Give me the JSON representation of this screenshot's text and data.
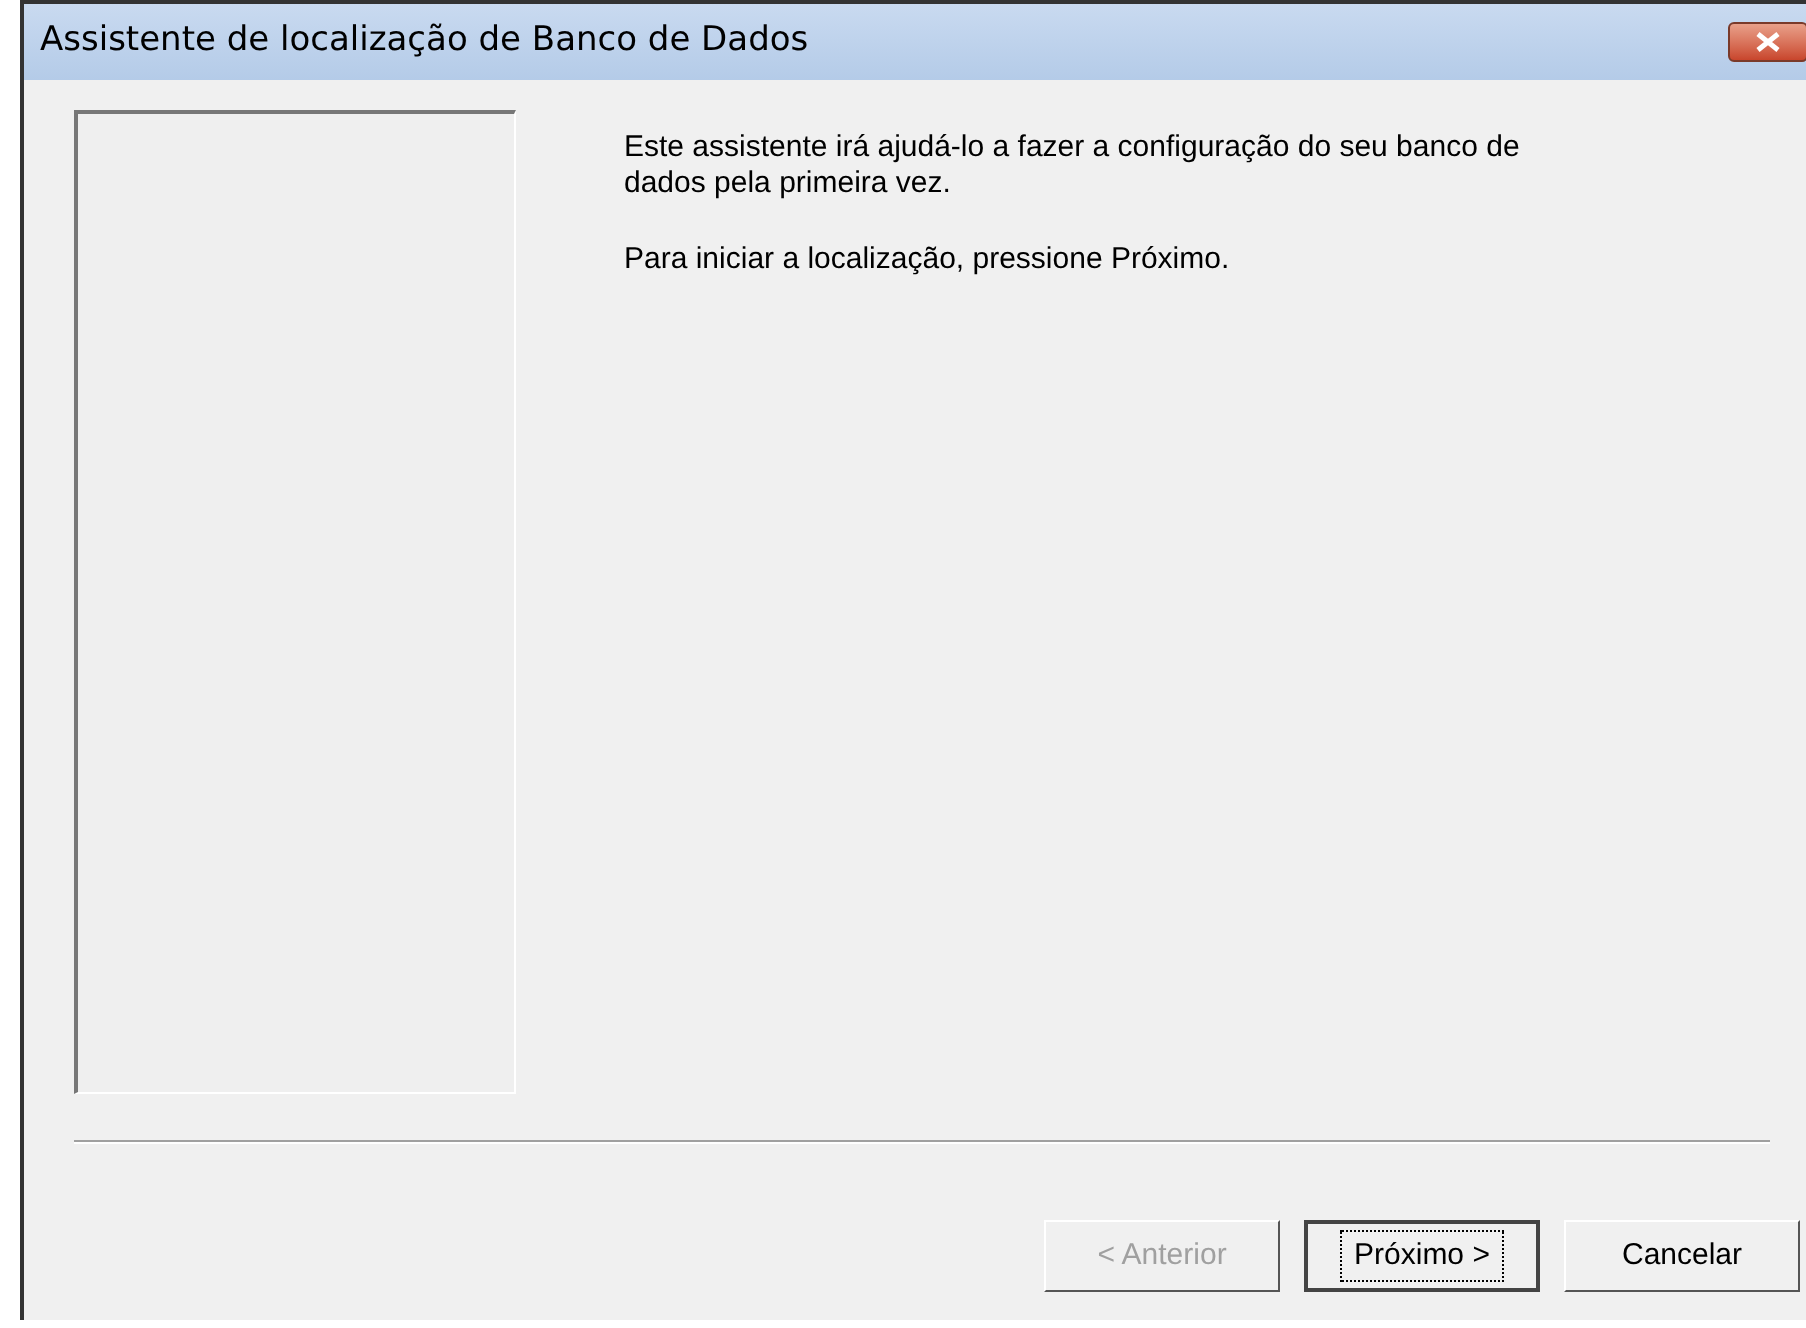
{
  "window": {
    "title": "Assistente de localização de Banco de Dados"
  },
  "paragraphs": [
    "Este assistente irá ajudá-lo a fazer a configuração do seu banco de dados pela primeira vez.",
    "Para iniciar a localização, pressione Próximo."
  ],
  "buttons": [
    {
      "label": "< Anterior",
      "disabled": true,
      "focused": false
    },
    {
      "label": "Próximo >",
      "disabled": false,
      "focused": true
    },
    {
      "label": "Cancelar",
      "disabled": false,
      "focused": false
    }
  ]
}
